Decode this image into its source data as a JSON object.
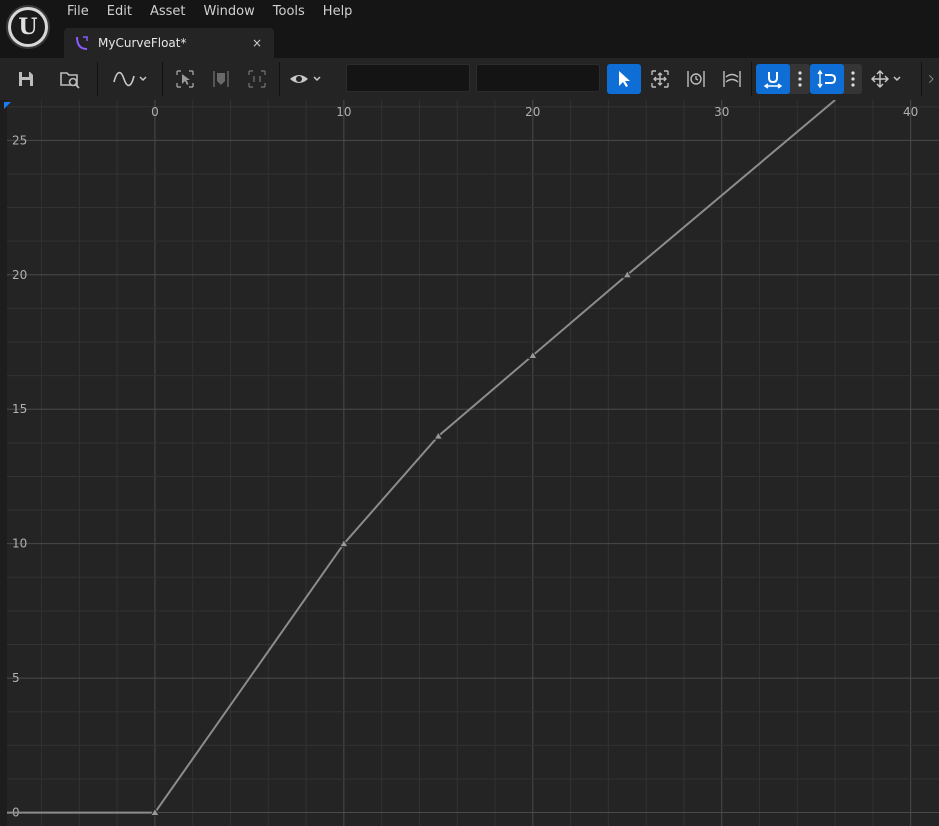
{
  "app": {
    "menu": [
      "File",
      "Edit",
      "Asset",
      "Window",
      "Tools",
      "Help"
    ],
    "tab": {
      "label": "MyCurveFloat*",
      "close": "×"
    },
    "logo_letter": "U"
  },
  "toolbar": {
    "frame_input": {
      "value": "",
      "placeholder": ""
    },
    "value_input": {
      "value": "",
      "placeholder": ""
    },
    "icons": [
      "save-icon",
      "browse-asset-icon",
      "curve-view-mode-icon",
      "select-icon",
      "key-icon",
      "frame-icon",
      "visibility-icon",
      "select-tool-icon",
      "transform-tool-icon",
      "retime-tool-icon",
      "multi-scale-icon",
      "snap-time-icon",
      "snap-value-icon",
      "axis-snap-icon"
    ]
  },
  "colors": {
    "accent": "#0e6ed6",
    "graph_bg": "#242424",
    "grid_major": "#4a4a4a",
    "grid_minor": "#323232",
    "curve": "#8c8c8c"
  },
  "chart_data": {
    "type": "line",
    "x_ticks": [
      "0",
      "10",
      "20",
      "30",
      "40"
    ],
    "y_ticks": [
      "0",
      "5",
      "10",
      "15",
      "20",
      "25"
    ],
    "xlim": [
      -8.2,
      41.5
    ],
    "ylim": [
      -0.5,
      26.5
    ],
    "x_minor_step": 2,
    "y_minor_step": 1.25,
    "series": [
      {
        "keys": [
          {
            "x": 0,
            "y": 0
          },
          {
            "x": 10,
            "y": 10
          },
          {
            "x": 15,
            "y": 14
          },
          {
            "x": 20,
            "y": 17
          },
          {
            "x": 25,
            "y": 20
          }
        ],
        "pre_extrapolate_value": 0,
        "post_extension_end": {
          "x": 36,
          "y": 26.5
        }
      }
    ],
    "grid": true
  }
}
